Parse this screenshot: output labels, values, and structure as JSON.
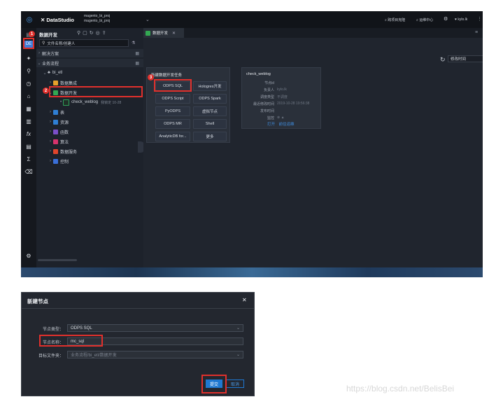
{
  "topbar": {
    "app_name": "DataStudio",
    "project_line1": "magento_bi_proj",
    "project_line2": "magento_bi_proj",
    "cross_project": "跨项目克隆",
    "ops_center": "运维中心",
    "user": "kylo.lk"
  },
  "tree": {
    "title": "数据开发",
    "search_placeholder": "文件名称/创建人",
    "solutions": "解决方案",
    "workflows": "业务流程",
    "flow_name": "bi_etl",
    "integration": "数据集成",
    "data_dev": "数据开发",
    "node_name": "check_weblog",
    "node_meta": "我锁定 10-28",
    "table": "表",
    "resource": "资源",
    "function": "函数",
    "algorithm": "算法",
    "data_service": "数据服务",
    "control": "控制"
  },
  "tab": {
    "label": "数据开发"
  },
  "sort": {
    "label": "修改时间"
  },
  "new_task_panel": {
    "title": "新建数据开发任务",
    "buttons": [
      "ODPS SQL",
      "Hologres开发",
      "ODPS Script",
      "ODPS Spark",
      "PyODPS",
      "虚拟节点",
      "ODPS MR",
      "Shell",
      "AnalyticDB for...",
      "更多"
    ]
  },
  "info_panel": {
    "title": "check_weblog",
    "rows": [
      {
        "k": "节点id",
        "v": ""
      },
      {
        "k": "负责人",
        "v": "kylo.lk"
      },
      {
        "k": "调度类型",
        "v": "不调度"
      },
      {
        "k": "最近修改时间",
        "v": "2019-10-28 19:56:38"
      },
      {
        "k": "发布时间",
        "v": ""
      },
      {
        "k": "监控",
        "v": "⊗ ▲"
      }
    ],
    "link_open": "打开",
    "link_ops": "前往运维"
  },
  "markers": [
    "1",
    "2",
    "3"
  ],
  "dialog": {
    "title": "新建节点",
    "close": "✕",
    "type_label": "节点类型：",
    "type_value": "ODPS SQL",
    "name_label": "节点名称：",
    "name_value": "mc_sql",
    "folder_label": "目标文件夹：",
    "folder_value": "业务流程/bi_etl/数据开发",
    "submit": "提交",
    "cancel": "取消"
  },
  "watermark": "https://blog.csdn.net/BelisBei",
  "colors": {
    "accent": "#1f78d1",
    "marker": "#e0302c",
    "bg": "#1b1f27"
  }
}
